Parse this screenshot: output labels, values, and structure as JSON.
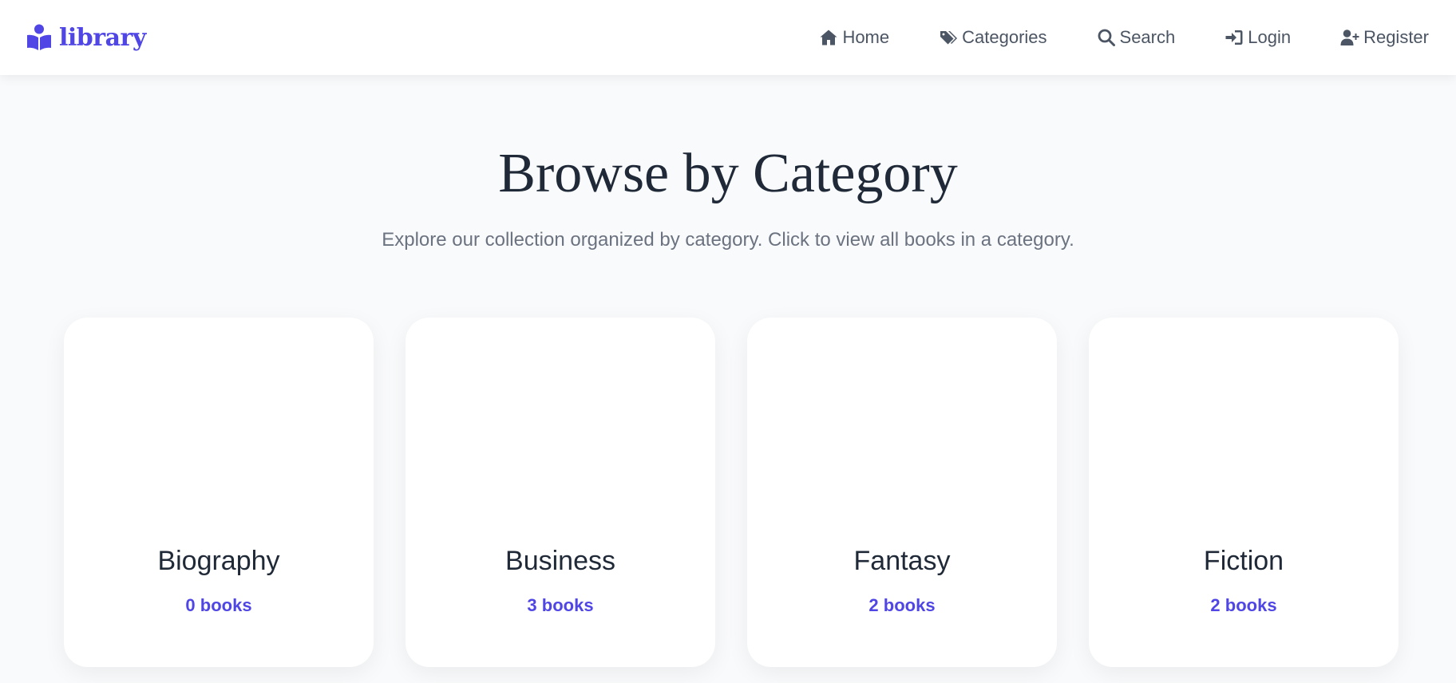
{
  "brand": {
    "name": "library",
    "icon": "reader-book-icon",
    "color": "#4f46e5"
  },
  "nav": {
    "items": [
      {
        "label": "Home",
        "icon": "home-icon"
      },
      {
        "label": "Categories",
        "icon": "tags-icon"
      },
      {
        "label": "Search",
        "icon": "search-icon"
      },
      {
        "label": "Login",
        "icon": "sign-in-icon"
      },
      {
        "label": "Register",
        "icon": "user-plus-icon"
      }
    ]
  },
  "hero": {
    "title": "Browse by Category",
    "subtitle": "Explore our collection organized by category. Click to view all books in a category."
  },
  "categories": [
    {
      "name": "Biography",
      "count": "0 books"
    },
    {
      "name": "Business",
      "count": "3 books"
    },
    {
      "name": "Fantasy",
      "count": "2 books"
    },
    {
      "name": "Fiction",
      "count": "2 books"
    }
  ],
  "colors": {
    "accent": "#4f46e5",
    "text": "#1f2937",
    "muted": "#6b7280",
    "background": "#f9fafb"
  }
}
